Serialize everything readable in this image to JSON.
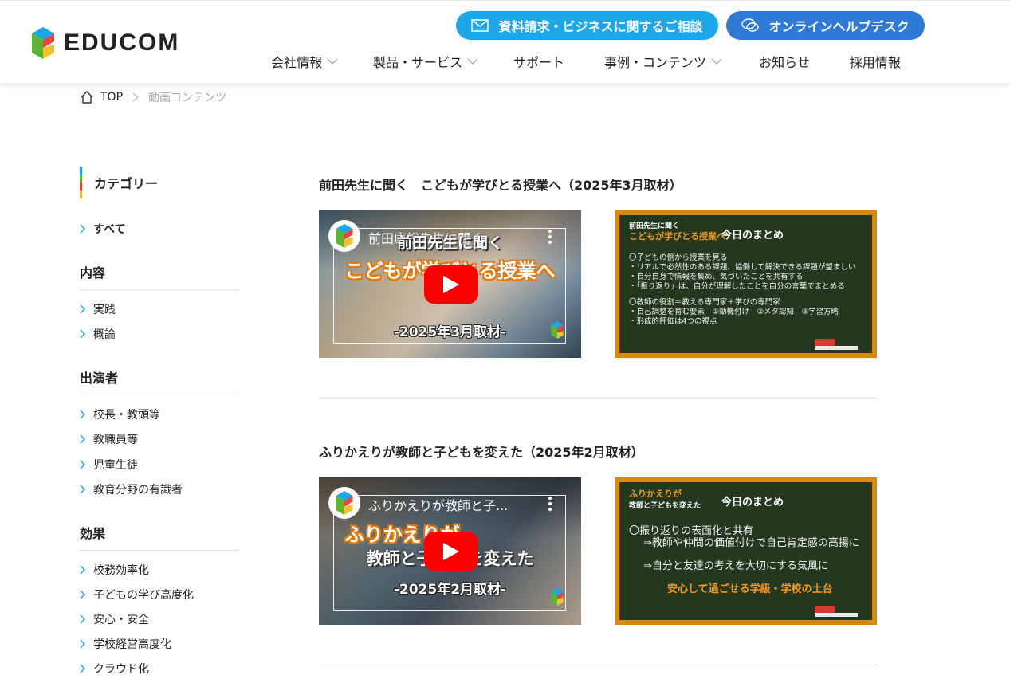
{
  "brand": {
    "name": "EDUCOM"
  },
  "header": {
    "contact_label": "資料請求・ビジネスに関するご相談",
    "help_label": "オンラインヘルプデスク",
    "nav": [
      {
        "label": "会社情報",
        "has_dropdown": true
      },
      {
        "label": "製品・サービス",
        "has_dropdown": true
      },
      {
        "label": "サポート",
        "has_dropdown": false
      },
      {
        "label": "事例・コンテンツ",
        "has_dropdown": true
      },
      {
        "label": "お知らせ",
        "has_dropdown": false
      },
      {
        "label": "採用情報",
        "has_dropdown": false
      }
    ]
  },
  "breadcrumb": {
    "home": "TOP",
    "current": "動画コンテンツ"
  },
  "sidebar": {
    "category_title": "カテゴリー",
    "all_label": "すべて",
    "groups": [
      {
        "heading": "内容",
        "items": [
          "実践",
          "概論"
        ]
      },
      {
        "heading": "出演者",
        "items": [
          "校長・教頭等",
          "教職員等",
          "児童生徒",
          "教育分野の有識者"
        ]
      },
      {
        "heading": "効果",
        "items": [
          "校務効率化",
          "子どもの学び高度化",
          "安心・安全",
          "学校経営高度化",
          "クラウド化"
        ]
      }
    ]
  },
  "entries": [
    {
      "title": "前田先生に聞く　こどもが学びとる授業へ（2025年3月取材）",
      "video": {
        "title": "前田康裕先生に聞く...",
        "headline_top": "前田先生に聞く",
        "headline_main": "こどもが学びとる授業へ",
        "date": "-2025年3月取材-"
      },
      "board": {
        "sub": "前田先生に聞く",
        "main": "こどもが学びとる授業へ",
        "summary": "今日のまとめ",
        "lines": [
          "〇子どもの側から授業を見る",
          "・リアルで必然性のある課題、協働して解決できる課題が望ましい",
          "・自分自身で情報を集め、気づいたことを共有する",
          "・「振り返り」は、自分が理解したことを自分の言葉でまとめる",
          "〇教師の役割＝教える専門家＋学びの専門家",
          "・自己調整を育む要素　①動機付け　②メタ認知　③学習方略",
          "・形成的評価は4つの視点"
        ]
      }
    },
    {
      "title": "ふりかえりが教師と子どもを変えた（2025年2月取材）",
      "video": {
        "title": "ふりかえりが教師と子...",
        "headline_top": "ふりかえりが",
        "headline_main": "教師と子どもを変えた",
        "date": "-2025年2月取材-"
      },
      "board": {
        "sub": "ふりかえりが",
        "main": "教師と子どもを変えた",
        "summary": "今日のまとめ",
        "lines": [
          "〇振り返りの表面化と共有",
          "⇒教師や仲間の価値付けで自己肯定感の高揚に",
          "⇒自分と友達の考えを大切にする気風に"
        ],
        "highlight": "安心して過ごせる学級・学校の土台"
      }
    }
  ],
  "colors": {
    "contact_button": "#1ea7e8",
    "help_button": "#2e7ad6",
    "board_frame": "#d78a0e",
    "board_bg": "#243820",
    "play_button": "#ff0000"
  }
}
